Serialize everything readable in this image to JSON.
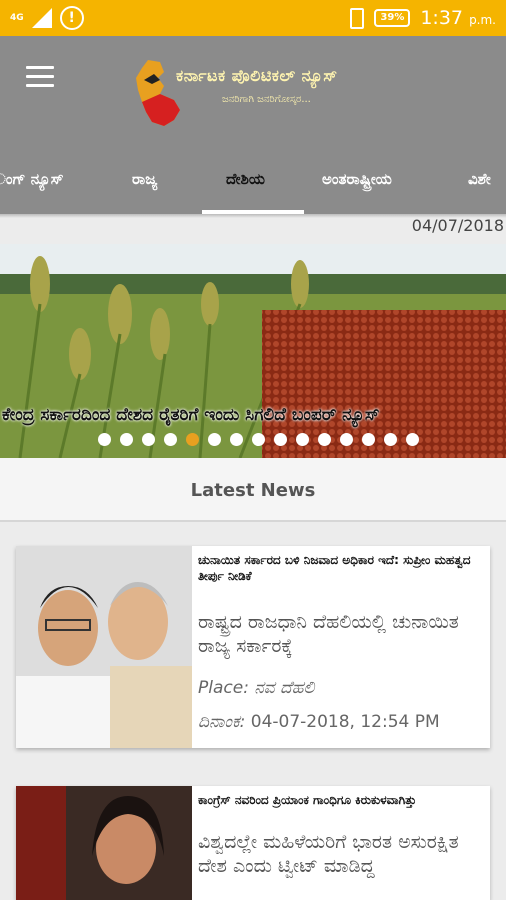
{
  "status_bar": {
    "network": "4G",
    "battery": "39%",
    "time": "1:37",
    "ampm": "p.m."
  },
  "header": {
    "title": "ಕರ್ನಾಟಕ ಪೊಲಿಟಿಕಲ್ ನ್ಯೂಸ್",
    "tagline": "ಜನರಿಗಾಗಿ ಜನರಿಗೋಸ್ಕರ..."
  },
  "tabs": [
    {
      "label": "ಂಗ್ ನ್ಯೂಸ್",
      "active": false
    },
    {
      "label": "ರಾಜ್ಯ",
      "active": false
    },
    {
      "label": "ದೇಶಿಯ",
      "active": true
    },
    {
      "label": "ಅಂತರಾಷ್ಟ್ರೀಯ",
      "active": false
    },
    {
      "label": "ವಿಶೇ",
      "active": false
    }
  ],
  "date": "04/07/2018",
  "banner": {
    "caption": "ಕೇಂದ್ರ ಸರ್ಕಾರದಿಂದ ದೇಶದ ರೈತರಿಗೆ ಇಂದು ಸಿಗಲಿದೆ ಬಂಪರ್ ನ್ಯೂಸ್",
    "dots_total": 15,
    "dots_active": 4
  },
  "section": {
    "title": "Latest News"
  },
  "news": [
    {
      "headline": "ಚುನಾಯಿತ ಸರ್ಕಾರದ ಬಳಿ ನಿಜವಾದ ಅಧಿಕಾರ ಇದೆ: ಸುಪ್ರೀಂ ಮಹತ್ವದ ತೀರ್ಪು ನೀಡಿಕೆ",
      "excerpt": "ರಾಷ್ಟ್ರದ ರಾಜಧಾನಿ ದೆಹಲಿಯಲ್ಲಿ ಚುನಾಯಿತ ರಾಜ್ಯ ಸರ್ಕಾರಕ್ಕೆ",
      "place_label": "Place:",
      "place": "ನವ ದೆಹಲಿ",
      "date_label": "ದಿನಾಂಕ:",
      "date": "04-07-2018, 12:54 PM"
    },
    {
      "headline": "ಕಾಂಗ್ರೆಸ್ ನವರಿಂದ ಪ್ರಿಯಾಂಕ ಗಾಂಧಿಗೂ ಕಿರುಕುಳವಾಗಿತ್ತು",
      "excerpt": "ವಿಶ್ವದಲ್ಲೇ ಮಹಿಳೆಯರಿಗೆ ಭಾರತ ಅಸುರಕ್ಷಿತ ದೇಶ ಎಂದು ಟ್ವೀಟ್ ಮಾಡಿದ್ದ"
    }
  ],
  "colors": {
    "status_bar": "#f5b400",
    "app_bar": "#8b8b8b",
    "dot_active": "#e8a020"
  }
}
